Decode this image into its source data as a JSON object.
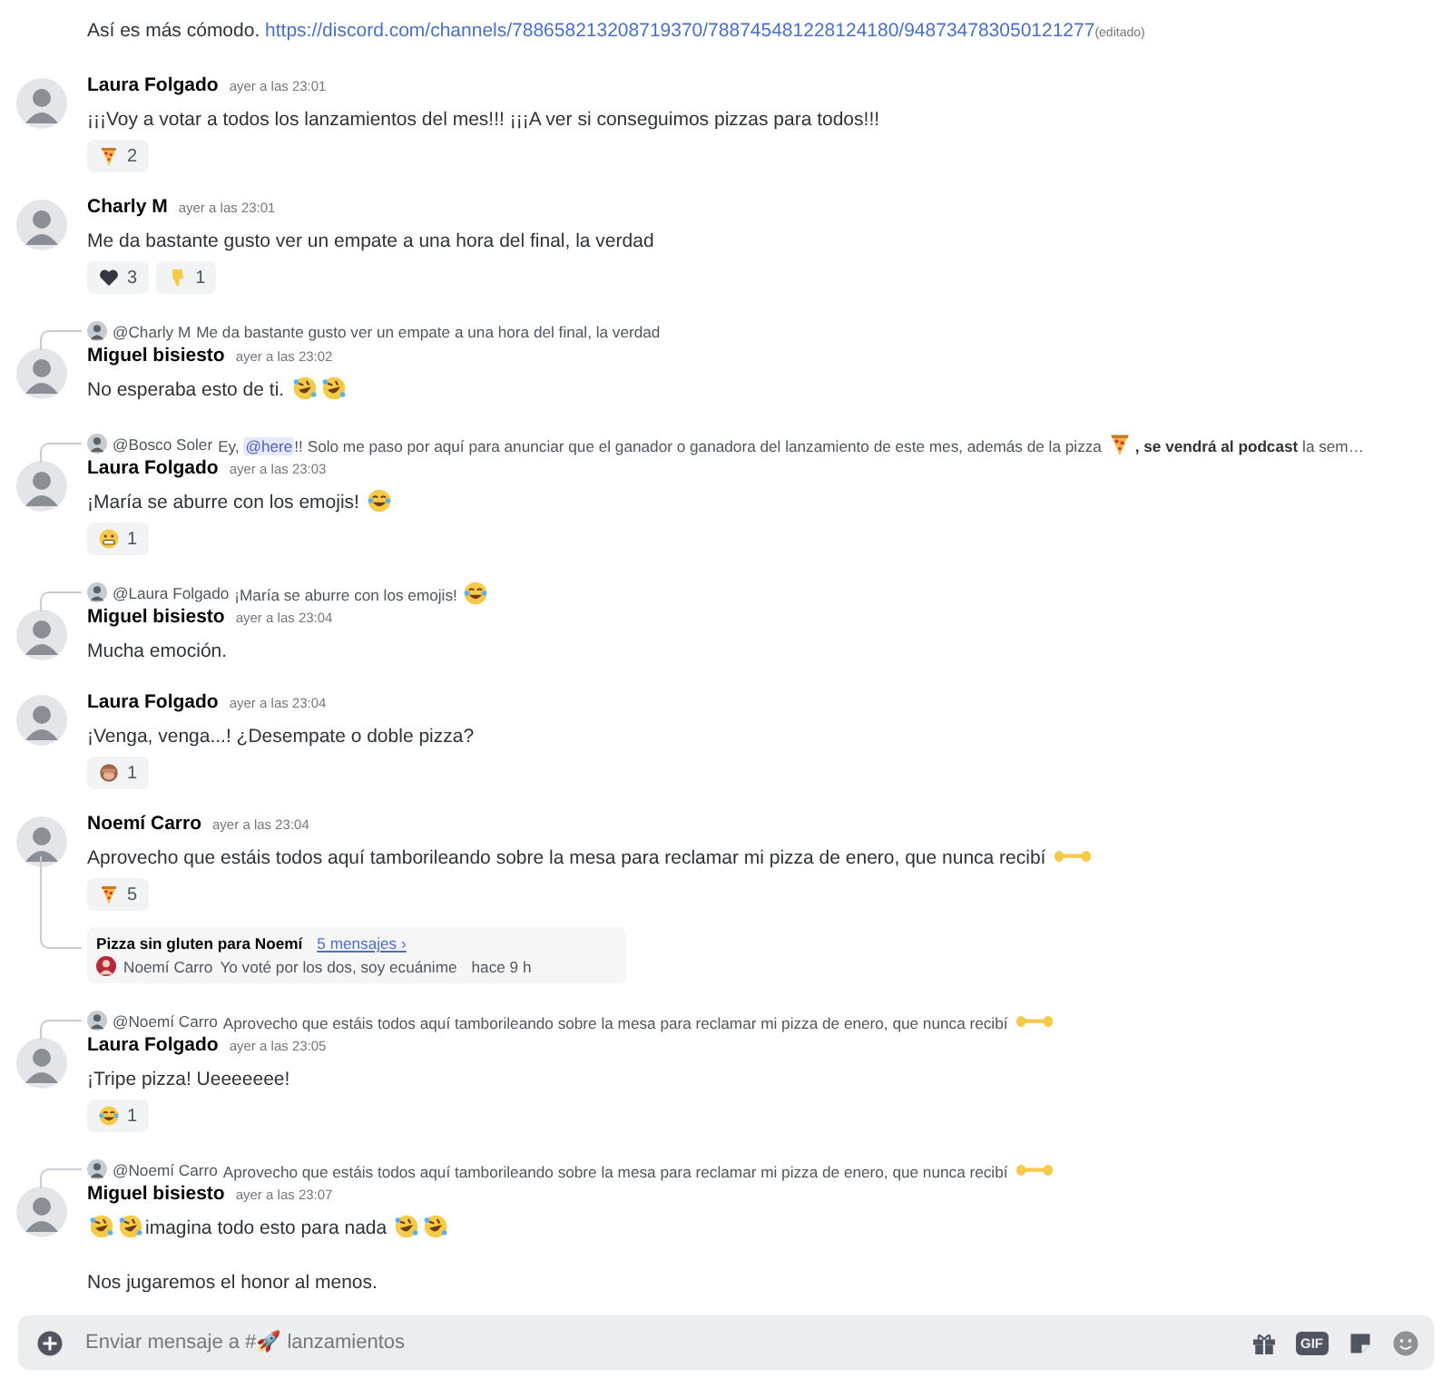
{
  "messages": [
    {
      "continuation": true,
      "content": [
        [
          {
            "kind": "text",
            "text": "Así es más cómodo. "
          },
          {
            "kind": "link",
            "text": "https://discord.com/channels/788658213208719370/788745481228124180/948734783050121277"
          },
          {
            "kind": "small",
            "text": "(editado)"
          }
        ]
      ]
    },
    {
      "author": "Laura Folgado",
      "time": "ayer a las 23:01",
      "content": [
        [
          {
            "kind": "text",
            "text": "¡¡¡Voy a votar a todos los lanzamientos del mes!!! ¡¡¡A ver si conseguimos pizzas para todos!!!"
          }
        ]
      ],
      "reactions": [
        {
          "kind": "pizza",
          "count": "2"
        }
      ]
    },
    {
      "author": "Charly M",
      "time": "ayer a las 23:01",
      "content": [
        [
          {
            "kind": "text",
            "text": "Me da bastante gusto ver un empate a una hora del final, la verdad"
          }
        ]
      ],
      "reactions": [
        {
          "kind": "heart",
          "count": "3"
        },
        {
          "kind": "thumbsdown",
          "count": "1"
        }
      ]
    },
    {
      "author": "Miguel bisiesto",
      "time": "ayer a las 23:02",
      "reply": {
        "author": "@Charly M",
        "content": [
          {
            "kind": "text",
            "text": "Me da bastante gusto ver un empate a una hora del final, la verdad"
          }
        ]
      },
      "content": [
        [
          {
            "kind": "text",
            "text": "No esperaba esto de ti. "
          },
          {
            "kind": "rofl"
          },
          {
            "kind": "rofl"
          }
        ]
      ]
    },
    {
      "author": "Laura Folgado",
      "time": "ayer a las 23:03",
      "reply": {
        "author": "@Bosco Soler",
        "content": [
          {
            "kind": "text",
            "text": "Ey, "
          },
          {
            "kind": "mention",
            "text": "@here"
          },
          {
            "kind": "text",
            "text": "!! Solo me paso por aquí para anunciar que el ganador o ganadora del lanzamiento de este mes, además de la pizza "
          },
          {
            "kind": "pizza"
          },
          {
            "kind": "bold",
            "text": ", se vendrá al podcast"
          },
          {
            "kind": "text",
            "text": " la sem…"
          }
        ]
      },
      "content": [
        [
          {
            "kind": "text",
            "text": "¡María se aburre con los emojis! "
          },
          {
            "kind": "joy"
          }
        ]
      ],
      "reactions": [
        {
          "kind": "grimace",
          "count": "1"
        }
      ]
    },
    {
      "author": "Miguel bisiesto",
      "time": "ayer a las 23:04",
      "reply": {
        "author": "@Laura Folgado",
        "content": [
          {
            "kind": "text",
            "text": "¡María se aburre con los emojis! "
          },
          {
            "kind": "joy"
          }
        ]
      },
      "content": [
        [
          {
            "kind": "text",
            "text": "Mucha emoción."
          }
        ]
      ]
    },
    {
      "author": "Laura Folgado",
      "time": "ayer a las 23:04",
      "content": [
        [
          {
            "kind": "text",
            "text": "¡Venga, venga...! ¿Desempate o doble pizza?"
          }
        ]
      ],
      "reactions": [
        {
          "kind": "monkey",
          "count": "1"
        }
      ]
    },
    {
      "author": "Noemí Carro",
      "time": "ayer a las 23:04",
      "content": [
        [
          {
            "kind": "text",
            "text": "Aprovecho que estáis todos aquí tamborileando sobre la mesa para reclamar mi pizza de enero, que nunca recibí "
          },
          {
            "kind": "hands"
          }
        ]
      ],
      "reactions": [
        {
          "kind": "pizza",
          "count": "5"
        }
      ],
      "thread": {
        "title": "Pizza sin gluten para Noemí",
        "count": "5 mensajes ›",
        "last_author": "Noemí Carro",
        "last_text": "Yo voté por los dos, soy ecuánime",
        "last_time": "hace 9 h"
      }
    },
    {
      "author": "Laura Folgado",
      "time": "ayer a las 23:05",
      "reply": {
        "author": "@Noemí Carro",
        "content": [
          {
            "kind": "text",
            "text": "Aprovecho que estáis todos aquí tamborileando sobre la mesa para reclamar mi pizza de enero, que nunca recibí "
          },
          {
            "kind": "hands"
          }
        ]
      },
      "content": [
        [
          {
            "kind": "text",
            "text": "¡Tripe pizza! Ueeeeeee!"
          }
        ]
      ],
      "reactions": [
        {
          "kind": "joy",
          "count": "1"
        }
      ]
    },
    {
      "author": "Miguel bisiesto",
      "time": "ayer a las 23:07",
      "reply": {
        "author": "@Noemí Carro",
        "content": [
          {
            "kind": "text",
            "text": "Aprovecho que estáis todos aquí tamborileando sobre la mesa para reclamar mi pizza de enero, que nunca recibí "
          },
          {
            "kind": "hands"
          }
        ]
      },
      "content": [
        [
          {
            "kind": "rofl"
          },
          {
            "kind": "rofl"
          },
          {
            "kind": "text",
            "text": "imagina todo esto para nada "
          },
          {
            "kind": "rofl"
          },
          {
            "kind": "rofl"
          }
        ],
        [
          {
            "kind": "text",
            "text": "Nos jugaremos el honor al menos."
          }
        ]
      ]
    }
  ],
  "composer": {
    "placeholder": "Enviar mensaje a #🚀 lanzamientos",
    "gif_label": "GIF"
  }
}
